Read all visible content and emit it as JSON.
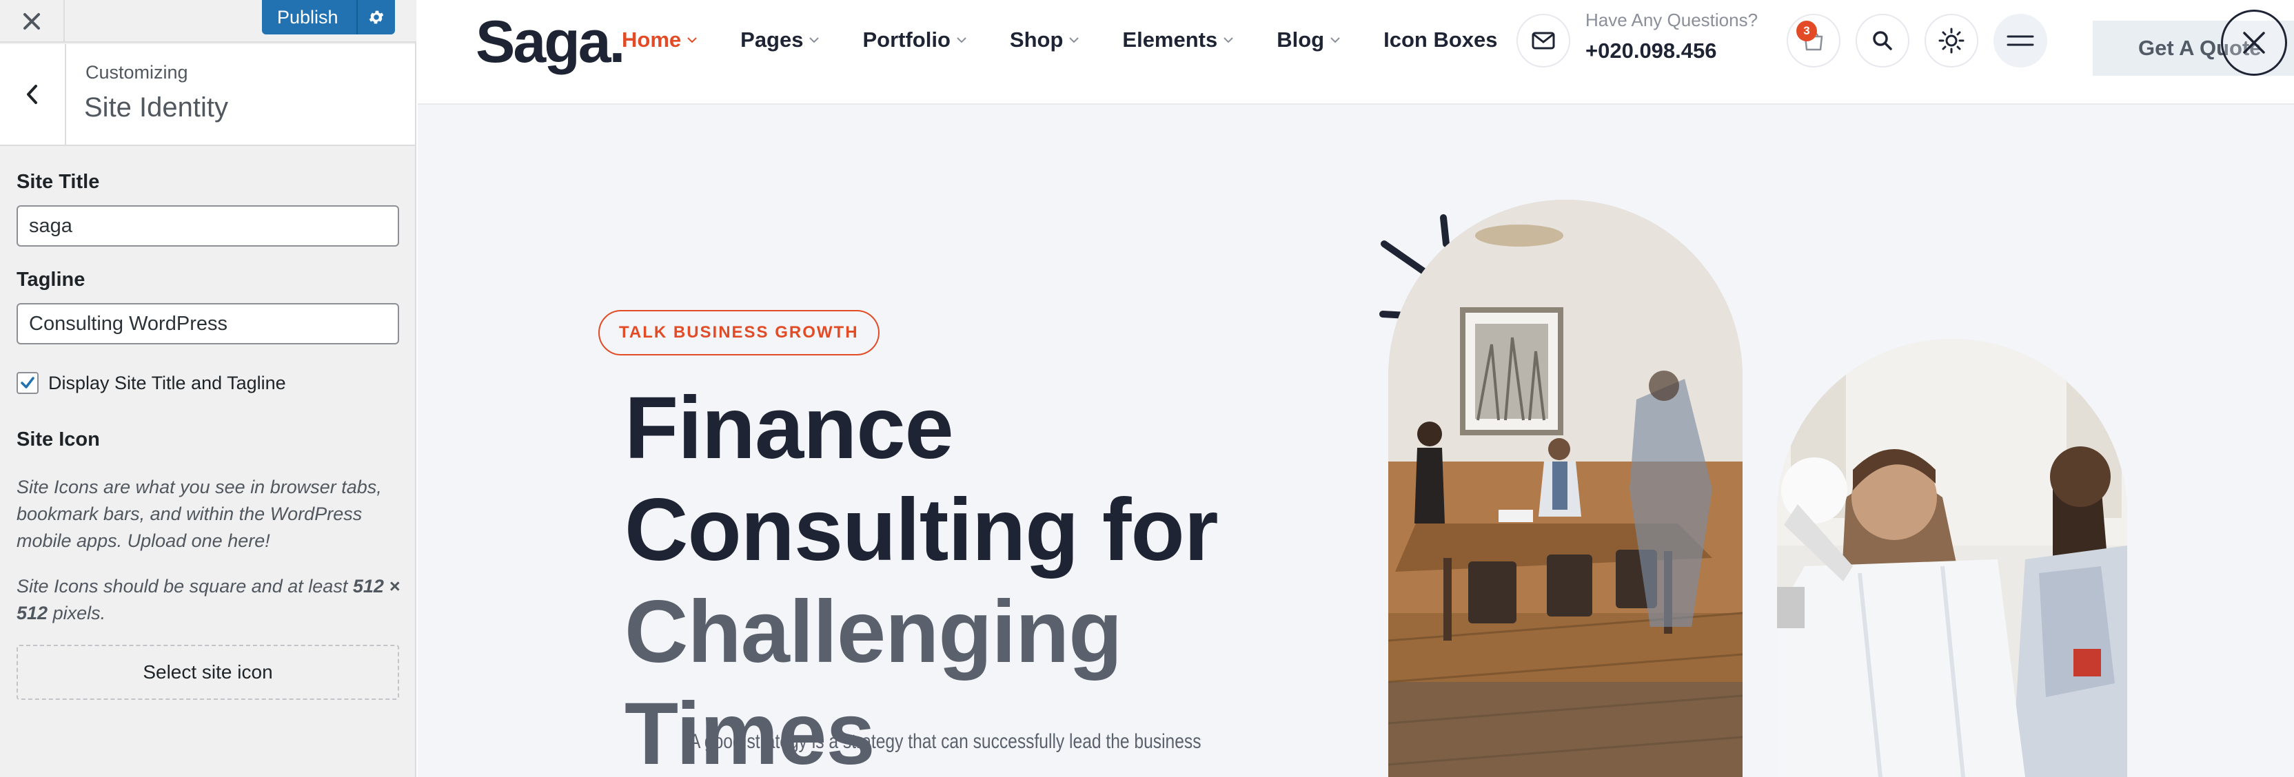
{
  "customizer": {
    "close_icon": "close-icon",
    "publish_label": "Publish",
    "settings_icon": "gear-icon",
    "back_icon": "chevron-left-icon",
    "breadcrumb": "Customizing",
    "section_title": "Site Identity",
    "site_title_label": "Site Title",
    "site_title_value": "saga",
    "tagline_label": "Tagline",
    "tagline_value": "Consulting WordPress",
    "display_checkbox_label": "Display Site Title and Tagline",
    "display_checkbox_checked": true,
    "site_icon_heading": "Site Icon",
    "site_icon_desc_1": "Site Icons are what you see in browser tabs, bookmark bars, and within the WordPress mobile apps. Upload one here!",
    "site_icon_desc_2_prefix": "Site Icons should be square and at least ",
    "site_icon_desc_2_bold": "512 × 512",
    "site_icon_desc_2_suffix": " pixels.",
    "select_icon_label": "Select site icon",
    "colors": {
      "accent": "#2271b1",
      "panel_bg": "#f0f0f1"
    }
  },
  "site": {
    "logo": "Saga.",
    "nav": [
      {
        "label": "Home",
        "active": true,
        "dropdown": true
      },
      {
        "label": "Pages",
        "active": false,
        "dropdown": true
      },
      {
        "label": "Portfolio",
        "active": false,
        "dropdown": true
      },
      {
        "label": "Shop",
        "active": false,
        "dropdown": true
      },
      {
        "label": "Elements",
        "active": false,
        "dropdown": true
      },
      {
        "label": "Blog",
        "active": false,
        "dropdown": true
      },
      {
        "label": "Icon Boxes",
        "active": false,
        "dropdown": false
      }
    ],
    "contact_question": "Have Any Questions?",
    "contact_phone": "+020.098.456",
    "cart_count": "3",
    "quote_button": "Get A Quote",
    "icons": [
      "mail-icon",
      "cart-icon",
      "search-icon",
      "sun-icon",
      "menu-icon",
      "close-icon"
    ],
    "colors": {
      "brand": "#e24b25",
      "dark": "#1e2433"
    }
  },
  "hero": {
    "badge": "TALK BUSINESS GROWTH",
    "headline_part1": "Finance Consulting for",
    "headline_part2": "Challenging Times",
    "subtitle": "A good strategy is a strategy that can successfully lead the business"
  }
}
